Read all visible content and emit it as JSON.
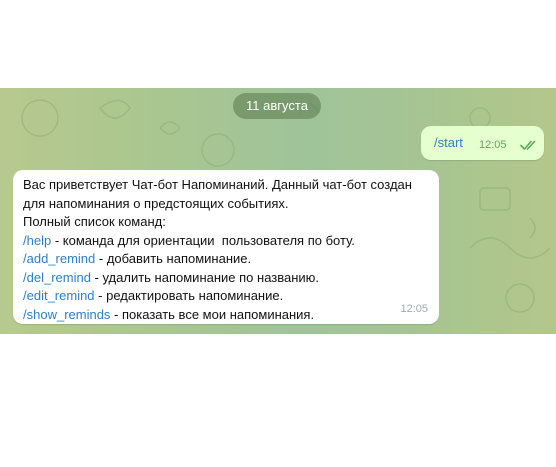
{
  "chat": {
    "date_separator": "11 августа",
    "outgoing": {
      "text": "/start",
      "time": "12:05",
      "status_icon": "double-check-icon"
    },
    "incoming": {
      "greeting_line1": "Вас приветствует Чат-бот Напоминаний. Данный чат-бот создан",
      "greeting_line2": "для напоминания о предстоящих событиях.",
      "list_heading": "Полный список команд:",
      "commands": [
        {
          "command": "/help",
          "description": " - команда для ориентации  пользователя по боту."
        },
        {
          "command": "/add_remind",
          "description": " - добавить напоминание."
        },
        {
          "command": "/del_remind",
          "description": " - удалить напоминание по названию."
        },
        {
          "command": "/edit_remind",
          "description": " - редактировать напоминание."
        },
        {
          "command": "/show_reminds",
          "description": " - показать все мои напоминания."
        }
      ],
      "time": "12:05"
    }
  },
  "colors": {
    "background_green": "#a9c690",
    "outgoing_bubble": "#e6ffce",
    "link_blue": "#2e7fc8",
    "checkmark_green": "#5aa85a"
  }
}
